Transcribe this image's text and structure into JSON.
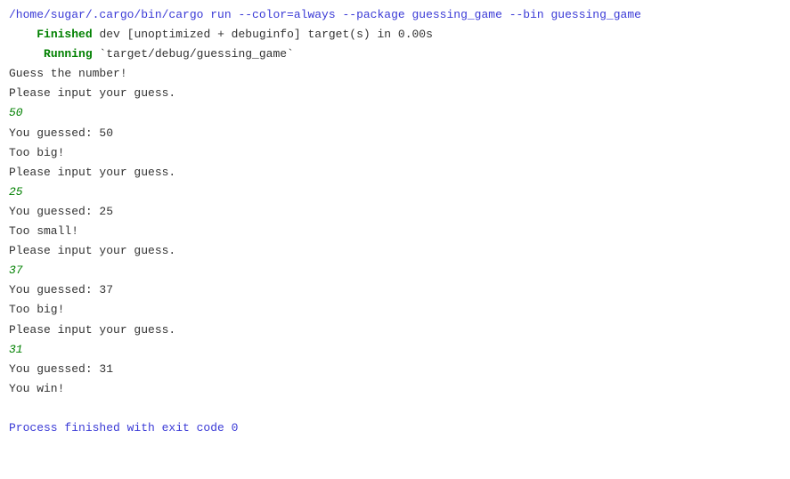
{
  "command": "/home/sugar/.cargo/bin/cargo run --color=always --package guessing_game --bin guessing_game",
  "finished_indent": "    ",
  "finished_label": "Finished",
  "finished_text": " dev [unoptimized + debuginfo] target(s) in 0.00s",
  "running_indent": "     ",
  "running_label": "Running",
  "running_text": " `target/debug/guessing_game`",
  "lines": {
    "intro": "Guess the number!",
    "prompt": "Please input your guess.",
    "guess1": "50",
    "resp1a": "You guessed: 50",
    "resp1b": "Too big!",
    "guess2": "25",
    "resp2a": "You guessed: 25",
    "resp2b": "Too small!",
    "guess3": "37",
    "resp3a": "You guessed: 37",
    "resp3b": "Too big!",
    "guess4": "31",
    "resp4a": "You guessed: 31",
    "resp4b": "You win!"
  },
  "exit": "Process finished with exit code 0"
}
